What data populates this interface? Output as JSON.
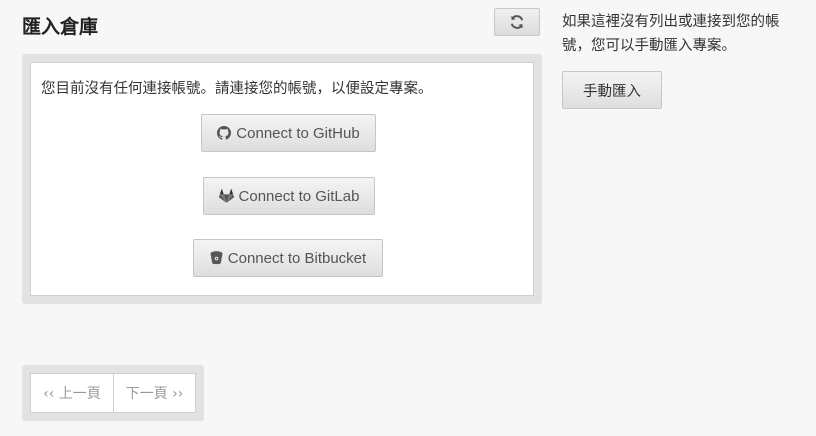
{
  "header": {
    "title": "匯入倉庫",
    "refresh_icon": "refresh-icon"
  },
  "panel": {
    "message": "您目前沒有任何連接帳號。請連接您的帳號，以便設定專案。",
    "buttons": [
      {
        "label": "Connect to GitHub",
        "icon": "github-icon"
      },
      {
        "label": "Connect to GitLab",
        "icon": "gitlab-icon"
      },
      {
        "label": "Connect to Bitbucket",
        "icon": "bitbucket-icon"
      }
    ]
  },
  "sidebar": {
    "help_text": "如果這裡沒有列出或連接到您的帳號，您可以手動匯入專案。",
    "manual_import_label": "手動匯入"
  },
  "pagination": {
    "prev_label": "‹‹ 上一頁",
    "next_label": "下一頁 ››"
  }
}
